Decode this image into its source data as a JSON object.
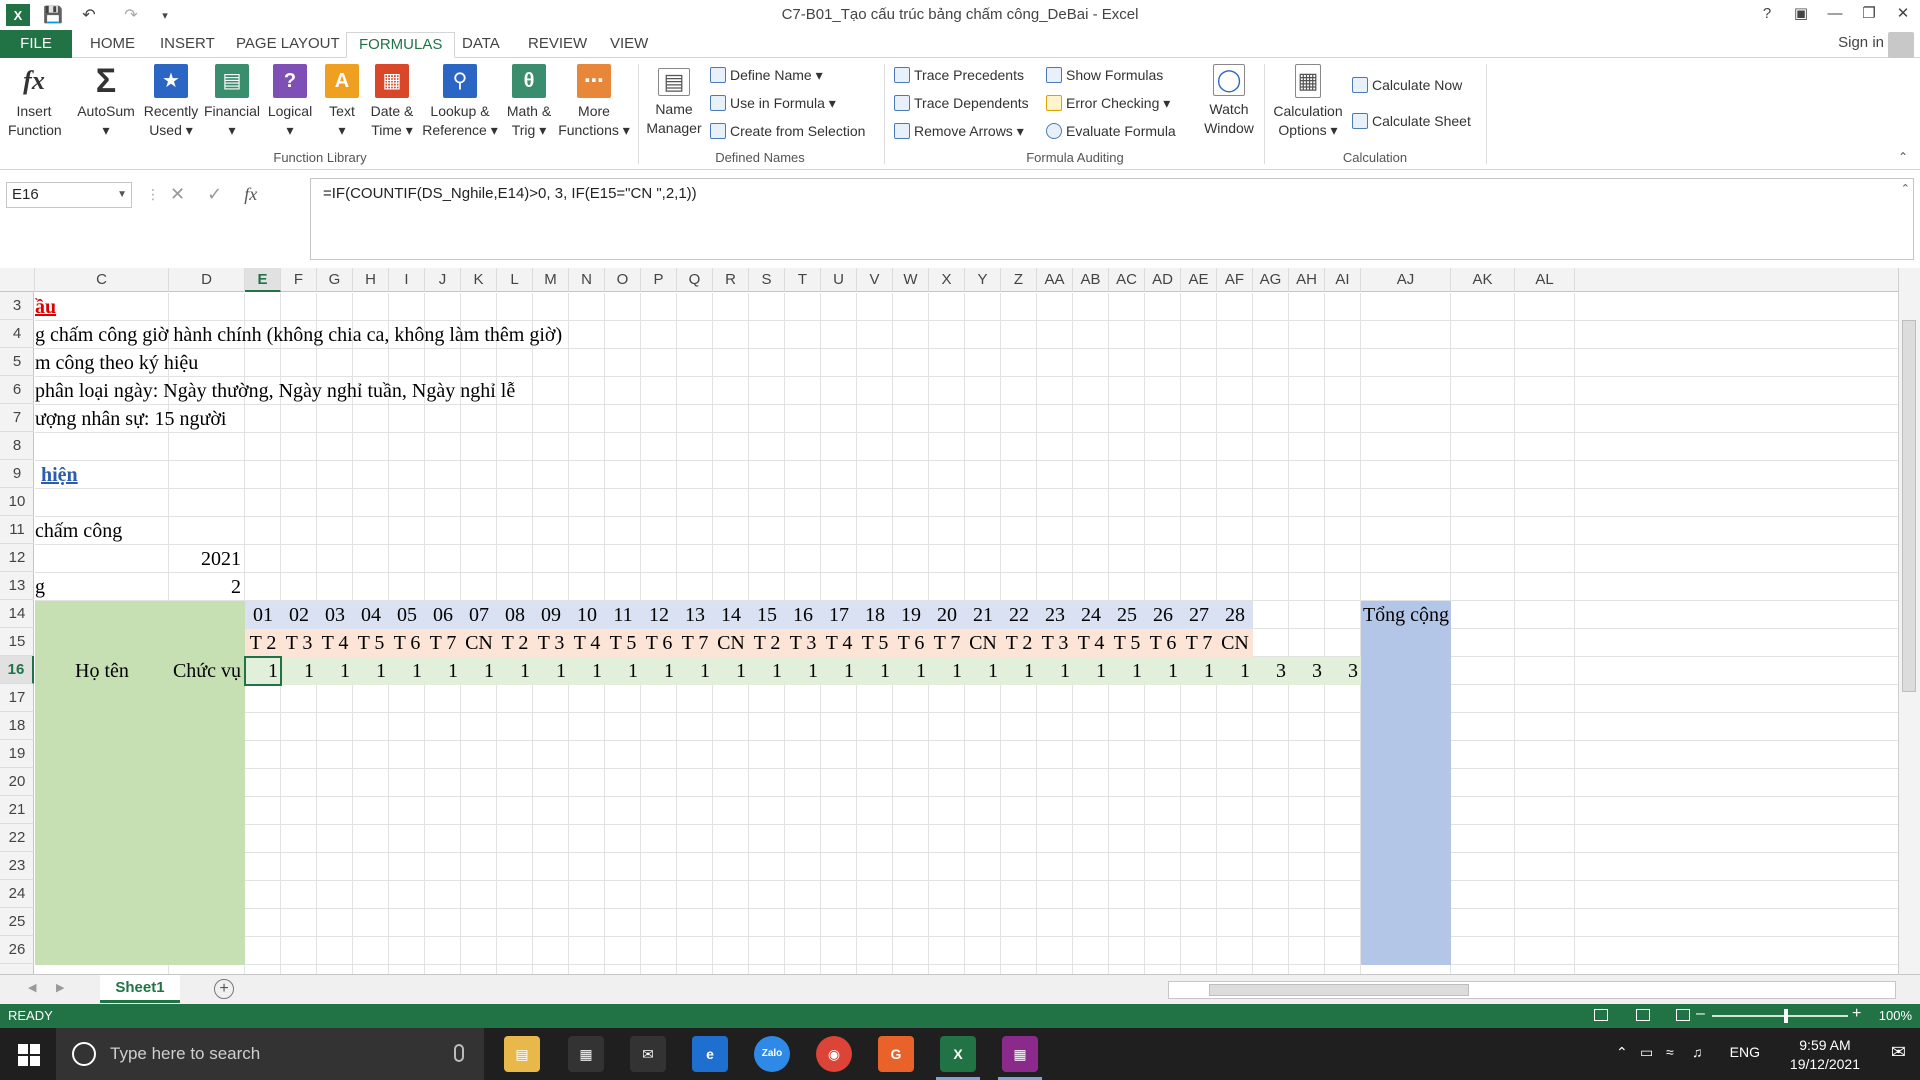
{
  "app": {
    "title": "C7-B01_Tạo cấu trúc bảng chấm công_DeBai - Excel",
    "help": "?",
    "signin": "Sign in"
  },
  "tabs": [
    "FILE",
    "HOME",
    "INSERT",
    "PAGE LAYOUT",
    "FORMULAS",
    "DATA",
    "REVIEW",
    "VIEW"
  ],
  "ribbon": {
    "function_library": {
      "label": "Function Library",
      "insert_function": [
        "Insert",
        "Function"
      ],
      "autosum": [
        "AutoSum",
        "▾"
      ],
      "recently_used": [
        "Recently",
        "Used ▾"
      ],
      "financial": [
        "Financial",
        "▾"
      ],
      "logical": [
        "Logical",
        "▾"
      ],
      "text": [
        "Text",
        "▾"
      ],
      "date_time": [
        "Date &",
        "Time ▾"
      ],
      "lookup": [
        "Lookup &",
        "Reference ▾"
      ],
      "math": [
        "Math &",
        "Trig ▾"
      ],
      "more": [
        "More",
        "Functions ▾"
      ]
    },
    "defined_names": {
      "label": "Defined Names",
      "name_manager": [
        "Name",
        "Manager"
      ],
      "define_name": "Define Name ▾",
      "use_in_formula": "Use in Formula ▾",
      "create_from_selection": "Create from Selection"
    },
    "formula_auditing": {
      "label": "Formula Auditing",
      "trace_precedents": "Trace Precedents",
      "trace_dependents": "Trace Dependents",
      "remove_arrows": "Remove Arrows ▾",
      "show_formulas": "Show Formulas",
      "error_checking": "Error Checking ▾",
      "evaluate_formula": "Evaluate Formula",
      "watch_window": [
        "Watch",
        "Window"
      ]
    },
    "calculation": {
      "label": "Calculation",
      "options": [
        "Calculation",
        "Options ▾"
      ],
      "calc_now": "Calculate Now",
      "calc_sheet": "Calculate Sheet"
    }
  },
  "formula_bar": {
    "name_box": "E16",
    "formula": "=IF(COUNTIF(DS_Nghile,E14)>0, 3, IF(E15=\"CN \",2,1))"
  },
  "grid": {
    "columns": [
      "C",
      "D",
      "E",
      "F",
      "G",
      "H",
      "I",
      "J",
      "K",
      "L",
      "M",
      "N",
      "O",
      "P",
      "Q",
      "R",
      "S",
      "T",
      "U",
      "V",
      "W",
      "X",
      "Y",
      "Z",
      "AA",
      "AB",
      "AC",
      "AD",
      "AE",
      "AF",
      "AG",
      "AH",
      "AI",
      "AJ",
      "AK",
      "AL"
    ],
    "rows": [
      "3",
      "4",
      "5",
      "6",
      "7",
      "8",
      "9",
      "10",
      "11",
      "12",
      "13",
      "14",
      "15",
      "16",
      "17",
      "18",
      "19",
      "20",
      "21",
      "22",
      "23",
      "24",
      "25",
      "26"
    ],
    "text_cells": {
      "r3": "ầu",
      "r4": "g chấm công giờ hành chính (không chia ca, không làm thêm giờ)",
      "r5": "m công theo ký hiệu",
      "r6": "phân loại ngày: Ngày thường, Ngày nghỉ tuần, Ngày nghỉ lễ",
      "r7": "ượng nhân sự: 15 người",
      "r9": "hiện",
      "r11": "chấm công",
      "r12_d": "2021",
      "r13_c": "g",
      "r13_d": "2",
      "ho_ten": "Họ tên",
      "chuc_vu": "Chức vụ",
      "tong_cong": "Tổng cộng"
    },
    "days": [
      "01",
      "02",
      "03",
      "04",
      "05",
      "06",
      "07",
      "08",
      "09",
      "10",
      "11",
      "12",
      "13",
      "14",
      "15",
      "16",
      "17",
      "18",
      "19",
      "20",
      "21",
      "22",
      "23",
      "24",
      "25",
      "26",
      "27",
      "28"
    ],
    "weekdays": [
      "T 2",
      "T 3",
      "T 4",
      "T 5",
      "T 6",
      "T 7",
      "CN",
      "T 2",
      "T 3",
      "T 4",
      "T 5",
      "T 6",
      "T 7",
      "CN",
      "T 2",
      "T 3",
      "T 4",
      "T 5",
      "T 6",
      "T 7",
      "CN",
      "T 2",
      "T 3",
      "T 4",
      "T 5",
      "T 6",
      "T 7",
      "CN"
    ],
    "codes": [
      "1",
      "1",
      "1",
      "1",
      "1",
      "1",
      "1",
      "1",
      "1",
      "1",
      "1",
      "1",
      "1",
      "1",
      "1",
      "1",
      "1",
      "1",
      "1",
      "1",
      "1",
      "1",
      "1",
      "1",
      "1",
      "1",
      "1",
      "1",
      "3",
      "3",
      "3"
    ]
  },
  "sheets": {
    "active": "Sheet1",
    "add": "+"
  },
  "status": {
    "ready": "READY",
    "zoom": "100%"
  },
  "taskbar": {
    "search_placeholder": "Type here to search",
    "language": "ENG",
    "time": "9:59 AM",
    "date": "19/12/2021"
  },
  "colors": {
    "excel_green": "#217346",
    "header_green": "#c6e0b4",
    "day_blue": "#d9e1f2",
    "weekday_peach": "#fce4d6",
    "code_green": "#e2efda",
    "total_blue": "#b4c6e7"
  }
}
